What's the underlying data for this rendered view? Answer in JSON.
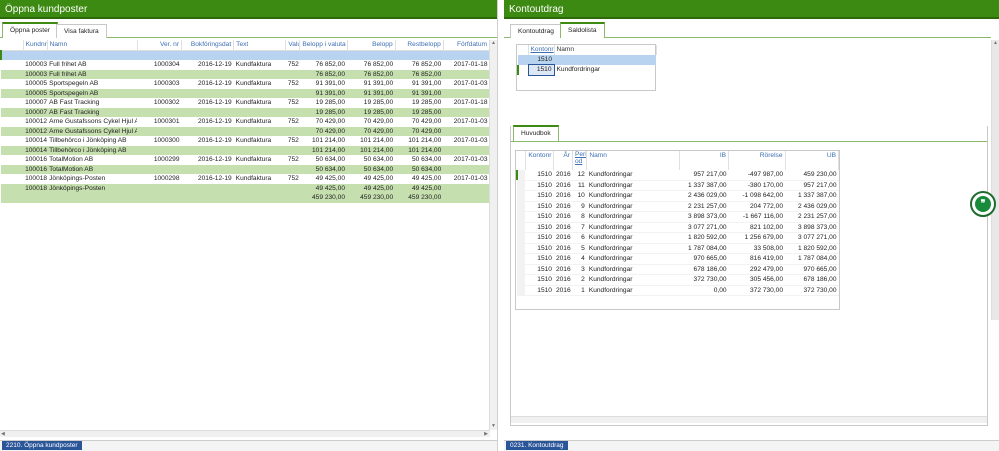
{
  "left": {
    "title": "Öppna kundposter",
    "tabs": [
      {
        "label": "Öppna poster"
      },
      {
        "label": "Visa faktura"
      }
    ],
    "columns": [
      "Kundnr",
      "Namn",
      "Ver. nr",
      "Bokföringsdat",
      "Text",
      "Valut",
      "Belopp i valuta",
      "Belopp",
      "Restbelopp",
      "Förfdatum"
    ],
    "rows": [
      {
        "type": "detail",
        "cells": [
          "100003",
          "Full frihet AB",
          "1000304",
          "2016-12-19",
          "Kundfaktura",
          "752",
          "76 852,00",
          "76 852,00",
          "76 852,00",
          "2017-01-18"
        ]
      },
      {
        "type": "sum",
        "cells": [
          "100003",
          "Full frihet AB",
          "",
          "",
          "",
          "",
          "76 852,00",
          "76 852,00",
          "76 852,00",
          ""
        ]
      },
      {
        "type": "detail",
        "cells": [
          "100005",
          "Sportspegeln AB",
          "1000303",
          "2016-12-19",
          "Kundfaktura",
          "752",
          "91 391,00",
          "91 391,00",
          "91 391,00",
          "2017-01-03"
        ]
      },
      {
        "type": "sum",
        "cells": [
          "100005",
          "Sportspegeln AB",
          "",
          "",
          "",
          "",
          "91 391,00",
          "91 391,00",
          "91 391,00",
          ""
        ]
      },
      {
        "type": "detail",
        "cells": [
          "100007",
          "AB Fast Tracking",
          "1000302",
          "2016-12-19",
          "Kundfaktura",
          "752",
          "19 285,00",
          "19 285,00",
          "19 285,00",
          "2017-01-18"
        ]
      },
      {
        "type": "sum",
        "cells": [
          "100007",
          "AB Fast Tracking",
          "",
          "",
          "",
          "",
          "19 285,00",
          "19 285,00",
          "19 285,00",
          ""
        ]
      },
      {
        "type": "detail",
        "cells": [
          "100012",
          "Arne Gustafssons Cykel Hjul AB",
          "1000301",
          "2016-12-19",
          "Kundfaktura",
          "752",
          "70 429,00",
          "70 429,00",
          "70 429,00",
          "2017-01-03"
        ]
      },
      {
        "type": "sum",
        "cells": [
          "100012",
          "Arne Gustafssons Cykel Hjul AB",
          "",
          "",
          "",
          "",
          "70 429,00",
          "70 429,00",
          "70 429,00",
          ""
        ]
      },
      {
        "type": "detail",
        "cells": [
          "100014",
          "Tillbehörco i Jönköping AB",
          "1000300",
          "2016-12-19",
          "Kundfaktura",
          "752",
          "101 214,00",
          "101 214,00",
          "101 214,00",
          "2017-01-03"
        ]
      },
      {
        "type": "sum",
        "cells": [
          "100014",
          "Tillbehörco i Jönköping AB",
          "",
          "",
          "",
          "",
          "101 214,00",
          "101 214,00",
          "101 214,00",
          ""
        ]
      },
      {
        "type": "detail",
        "cells": [
          "100016",
          "TotalMotion AB",
          "1000299",
          "2016-12-19",
          "Kundfaktura",
          "752",
          "50 634,00",
          "50 634,00",
          "50 634,00",
          "2017-01-03"
        ]
      },
      {
        "type": "sum",
        "cells": [
          "100016",
          "TotalMotion AB",
          "",
          "",
          "",
          "",
          "50 634,00",
          "50 634,00",
          "50 634,00",
          ""
        ]
      },
      {
        "type": "detail",
        "cells": [
          "100018",
          "Jönköpings-Posten",
          "1000298",
          "2016-12-19",
          "Kundfaktura",
          "752",
          "49 425,00",
          "49 425,00",
          "49 425,00",
          "2017-01-03"
        ]
      },
      {
        "type": "sum",
        "cells": [
          "100018",
          "Jönköpings-Posten",
          "",
          "",
          "",
          "",
          "49 425,00",
          "49 425,00",
          "49 425,00",
          ""
        ]
      },
      {
        "type": "sum",
        "cells": [
          "",
          "",
          "",
          "",
          "",
          "",
          "459 230,00",
          "459 230,00",
          "459 230,00",
          ""
        ]
      }
    ],
    "status": "2210. Öppna kundposter"
  },
  "right": {
    "title": "Kontoutdrag",
    "tabs": [
      {
        "label": "Kontoutdrag"
      },
      {
        "label": "Saldolista"
      }
    ],
    "saldo": {
      "columns": [
        "Kontonr",
        "Namn"
      ],
      "rows": [
        [
          "1510",
          ""
        ],
        [
          "1510",
          "Kundfordringar"
        ]
      ]
    },
    "huvudbok": {
      "tab_label": "Huvudbok",
      "columns": [
        "Kontonr",
        "År",
        "Peri-od",
        "Namn",
        "IB",
        "Rörelse",
        "UB"
      ],
      "rows": [
        [
          "1510",
          "2016",
          "12",
          "Kundfordringar",
          "957 217,00",
          "-497 987,00",
          "459 230,00"
        ],
        [
          "1510",
          "2016",
          "11",
          "Kundfordringar",
          "1 337 387,00",
          "-380 170,00",
          "957 217,00"
        ],
        [
          "1510",
          "2016",
          "10",
          "Kundfordringar",
          "2 436 029,00",
          "-1 098 642,00",
          "1 337 387,00"
        ],
        [
          "1510",
          "2016",
          "9",
          "Kundfordringar",
          "2 231 257,00",
          "204 772,00",
          "2 436 029,00"
        ],
        [
          "1510",
          "2016",
          "8",
          "Kundfordringar",
          "3 898 373,00",
          "-1 667 116,00",
          "2 231 257,00"
        ],
        [
          "1510",
          "2016",
          "7",
          "Kundfordringar",
          "3 077 271,00",
          "821 102,00",
          "3 898 373,00"
        ],
        [
          "1510",
          "2016",
          "6",
          "Kundfordringar",
          "1 820 592,00",
          "1 256 679,00",
          "3 077 271,00"
        ],
        [
          "1510",
          "2016",
          "5",
          "Kundfordringar",
          "1 787 084,00",
          "33 508,00",
          "1 820 592,00"
        ],
        [
          "1510",
          "2016",
          "4",
          "Kundfordringar",
          "970 665,00",
          "816 419,00",
          "1 787 084,00"
        ],
        [
          "1510",
          "2016",
          "3",
          "Kundfordringar",
          "678 186,00",
          "292 479,00",
          "970 665,00"
        ],
        [
          "1510",
          "2016",
          "2",
          "Kundfordringar",
          "372 730,00",
          "305 456,00",
          "678 186,00"
        ],
        [
          "1510",
          "2016",
          "1",
          "Kundfordringar",
          "0,00",
          "372 730,00",
          "372 730,00"
        ]
      ]
    },
    "status": "0231. Kontoutdrag"
  },
  "chat_glyph": "❞",
  "colors": {
    "titlebar": "#3d8a12",
    "sum_row": "#c5dfae",
    "header_text": "#3d6fb3",
    "selection": "#b8d3f0",
    "status": "#2a5599"
  }
}
